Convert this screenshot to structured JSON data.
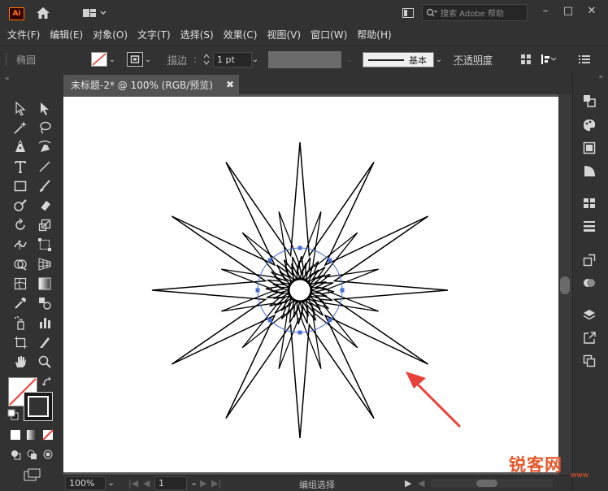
{
  "app": {
    "logo_text": "Ai",
    "search_placeholder": "搜索 Adobe 帮助"
  },
  "menu": [
    "文件(F)",
    "编辑(E)",
    "对象(O)",
    "文字(T)",
    "选择(S)",
    "效果(C)",
    "视图(V)",
    "窗口(W)",
    "帮助(H)"
  ],
  "control": {
    "object_type": "椭圆",
    "stroke_label": "描边",
    "stroke_weight": "1 pt",
    "brush_profile": "基本",
    "opacity_label": "不透明度"
  },
  "document": {
    "tab_title": "未标题-2* @ 100% (RGB/预览)"
  },
  "status": {
    "zoom": "100%",
    "artboard_number": "1",
    "tool_status": "编组选择"
  },
  "watermark": {
    "text": "锐客网",
    "sub": "www"
  },
  "colors": {
    "ui_bg": "#323232",
    "canvas_bg": "#535353",
    "accent_arrow": "#e8433b",
    "selection_blue": "#4a6fcf",
    "logo": "#ff7c00"
  },
  "icons": [
    "home-icon",
    "workspace-switcher-icon",
    "search-icon",
    "minimize-icon",
    "maximize-icon",
    "close-icon"
  ]
}
